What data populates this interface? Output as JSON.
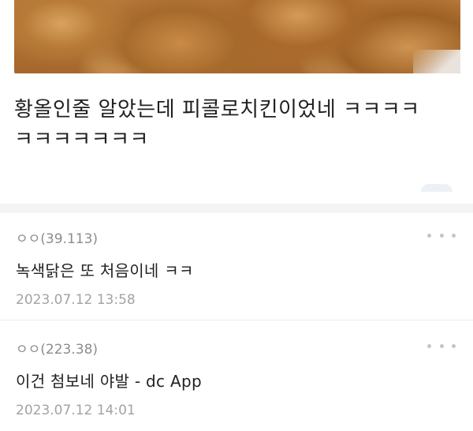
{
  "post": {
    "image_alt": "fried chicken photo",
    "body_text": "황올인줄 알았는데 피콜로치킨이었네 ㅋㅋㅋㅋ\nㅋㅋㅋㅋㅋㅋㅋ"
  },
  "comments": [
    {
      "author": "ㅇㅇ(39.113)",
      "text": "녹색닭은 또 처음이네 ㅋㅋ",
      "date": "2023.07.12 13:58",
      "menu_icon": "more-dots-icon"
    },
    {
      "author": "ㅇㅇ(223.38)",
      "text": "이건 첨보네 야발 - dc App",
      "date": "2023.07.12 14:01",
      "menu_icon": "more-dots-icon"
    }
  ]
}
